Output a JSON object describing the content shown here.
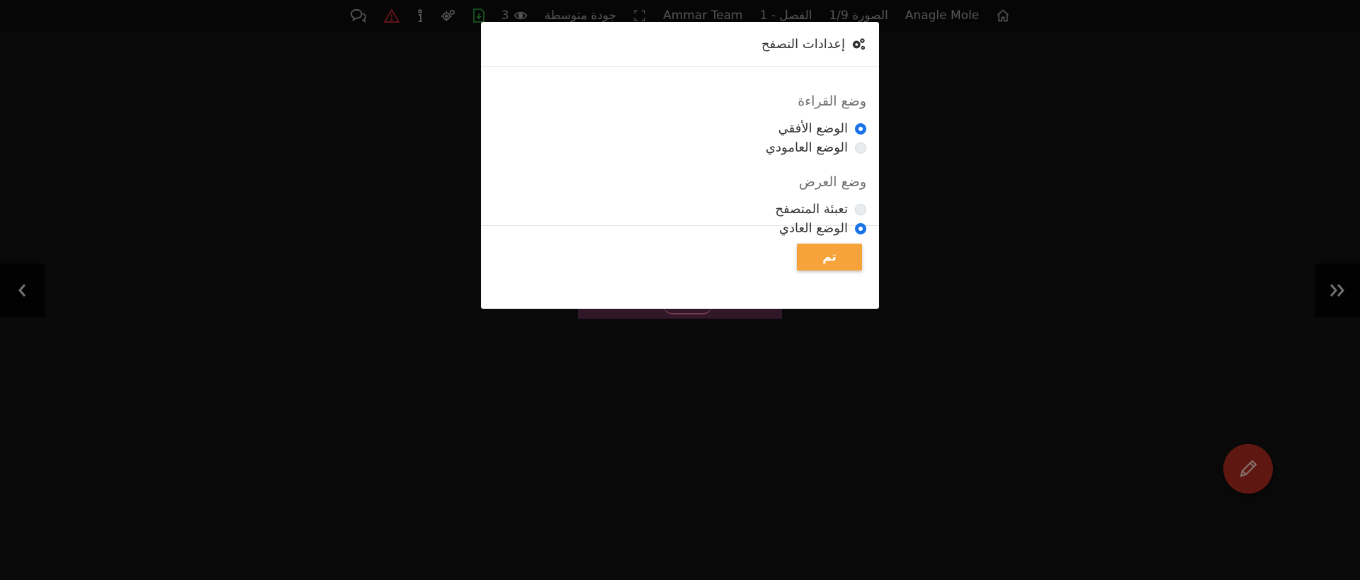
{
  "topbar": {
    "home_icon": "home-icon",
    "series_title": "Anagle Mole",
    "image_counter": "الصورة 1/9",
    "chapter": "الفصل - 1",
    "team": "Ammar Team",
    "fullscreen_icon": "fullscreen-icon",
    "quality": "جودة متوسطة",
    "views_count": "3",
    "views_icon": "eye-icon",
    "download_icon": "file-download-icon",
    "settings_icon": "gears-icon",
    "info_icon": "info-icon",
    "report_icon": "warning-icon",
    "comments_icon": "comments-icon",
    "colors": {
      "download": "#2e9e3b",
      "report": "#c0272d"
    }
  },
  "modal": {
    "title": "إعدادات التصفح",
    "reading_mode": {
      "title": "وضع القراءة",
      "options": [
        {
          "label": "الوضع الأفقي",
          "checked": true
        },
        {
          "label": "الوضع العامودي",
          "checked": false
        }
      ]
    },
    "display_mode": {
      "title": "وضع العرض",
      "options": [
        {
          "label": "تعبئة المتصفح",
          "checked": false
        },
        {
          "label": "الوضع العادي",
          "checked": true
        }
      ]
    },
    "ok_label": "تم"
  },
  "colors": {
    "accent_button": "#f5a33a",
    "radio_checked": "#1a73e8",
    "fab": "#ad2c1f",
    "background": "#121212"
  }
}
